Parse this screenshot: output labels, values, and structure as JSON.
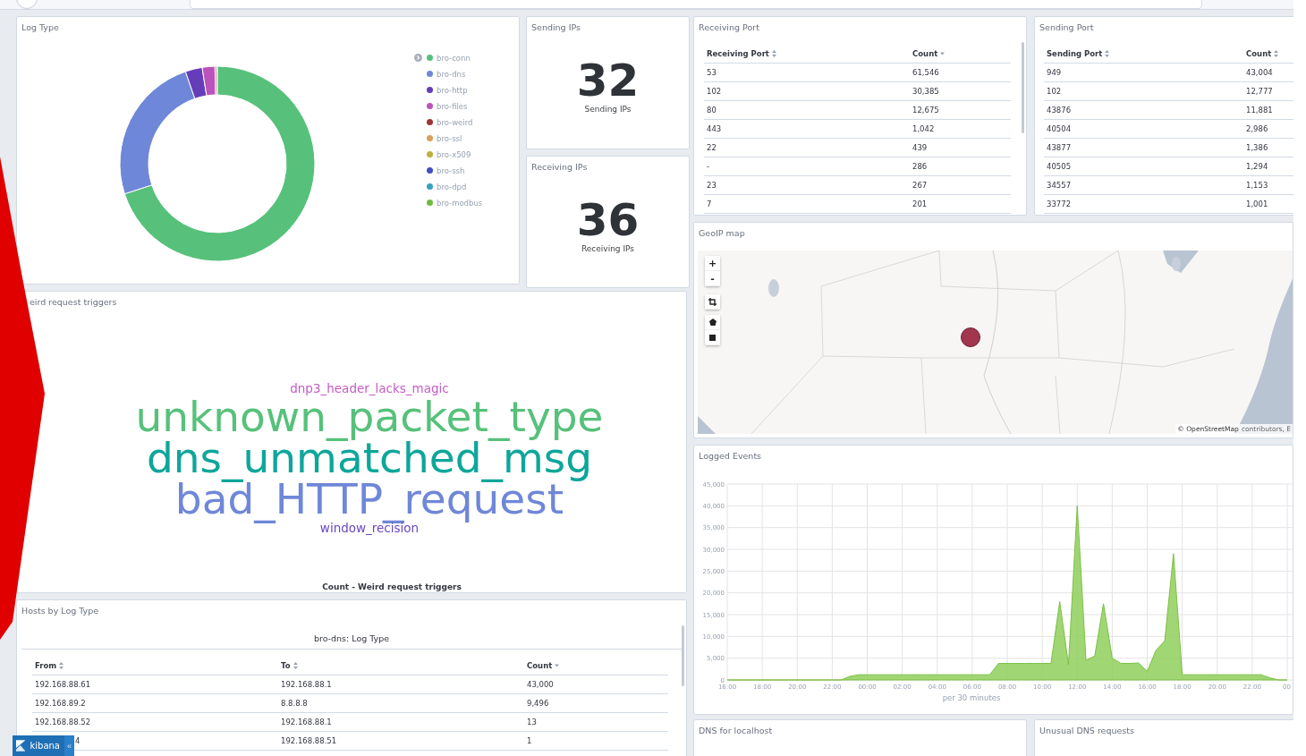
{
  "log_type": {
    "title": "Log Type",
    "legend": [
      {
        "label": "bro-conn",
        "color": "#57c17b"
      },
      {
        "label": "bro-dns",
        "color": "#6f87d8"
      },
      {
        "label": "bro-http",
        "color": "#663db8"
      },
      {
        "label": "bro-files",
        "color": "#bc52bc"
      },
      {
        "label": "bro-weird",
        "color": "#9e3533"
      },
      {
        "label": "bro-ssl",
        "color": "#daa05d"
      },
      {
        "label": "bro-x509",
        "color": "#bfaf40"
      },
      {
        "label": "bro-ssh",
        "color": "#4050bf"
      },
      {
        "label": "bro-dpd",
        "color": "#36a2bf"
      },
      {
        "label": "bro-modbus",
        "color": "#70ba40"
      }
    ]
  },
  "sending_ips": {
    "title": "Sending IPs",
    "value": "32",
    "label": "Sending IPs"
  },
  "receiving_ips": {
    "title": "Receiving IPs",
    "value": "36",
    "label": "Receiving IPs"
  },
  "receiving_port": {
    "title": "Receiving Port",
    "columns": [
      {
        "label": "Receiving Port",
        "sorted": false
      },
      {
        "label": "Count",
        "sorted": true
      }
    ],
    "rows": [
      [
        "53",
        "61,546"
      ],
      [
        "102",
        "30,385"
      ],
      [
        "80",
        "12,675"
      ],
      [
        "443",
        "1,042"
      ],
      [
        "22",
        "439"
      ],
      [
        "-",
        "286"
      ],
      [
        "23",
        "267"
      ],
      [
        "7",
        "201"
      ]
    ]
  },
  "sending_port": {
    "title": "Sending Port",
    "columns": [
      {
        "label": "Sending Port",
        "sorted": false
      },
      {
        "label": "Count",
        "sorted": false
      }
    ],
    "rows": [
      [
        "949",
        "43,004"
      ],
      [
        "102",
        "12,777"
      ],
      [
        "43876",
        "11,881"
      ],
      [
        "40504",
        "2,986"
      ],
      [
        "43877",
        "1,386"
      ],
      [
        "40505",
        "1,294"
      ],
      [
        "34557",
        "1,153"
      ],
      [
        "33772",
        "1,001"
      ]
    ]
  },
  "weird_triggers": {
    "title": "eird request triggers",
    "words": [
      {
        "text": "dnp3_header_lacks_magic",
        "kind": "small",
        "color": "#c65bc6"
      },
      {
        "text": "unknown_packet_type",
        "kind": "large",
        "color": "#57c17b"
      },
      {
        "text": "dns_unmatched_msg",
        "kind": "large",
        "color": "#0ea69a"
      },
      {
        "text": "bad_HTTP_request",
        "kind": "large",
        "color": "#6f87d8"
      },
      {
        "text": "window_recision",
        "kind": "small",
        "color": "#6a47c2"
      }
    ],
    "caption": "Count - Weird request triggers"
  },
  "hosts_by_log_type": {
    "title": "Hosts by Log Type",
    "subtitle": "bro-dns: Log Type",
    "columns": [
      {
        "label": "From",
        "sorted": false
      },
      {
        "label": "To",
        "sorted": false
      },
      {
        "label": "Count",
        "sorted": true
      }
    ],
    "rows": [
      [
        "192.168.88.61",
        "192.168.88.1",
        "43,000"
      ],
      [
        "192.168.89.2",
        "8.8.8.8",
        "9,496"
      ],
      [
        "192.168.88.52",
        "192.168.88.1",
        "13"
      ],
      [
        "4",
        "192.168.88.51",
        "1"
      ]
    ]
  },
  "geoip_map": {
    "title": "GeoIP map",
    "zoom_in": "+",
    "zoom_out": "-",
    "attribution_link": "© OpenStreetMap",
    "attribution_text": "contributors, E"
  },
  "logged_events": {
    "title": "Logged Events",
    "chart_data": {
      "type": "area",
      "xlabel": "per 30 minutes",
      "categories": [
        "16:00",
        null,
        null,
        null,
        "18:00",
        null,
        null,
        null,
        "20:00",
        null,
        null,
        null,
        "22:00",
        null,
        null,
        null,
        "00:00",
        null,
        null,
        null,
        "02:00",
        null,
        null,
        null,
        "04:00",
        null,
        null,
        null,
        "06:00",
        null,
        null,
        null,
        "08:00",
        null,
        null,
        null,
        "10:00",
        null,
        null,
        null,
        "12:00",
        null,
        null,
        null,
        "14:00",
        null,
        null,
        null,
        "16:00",
        null,
        null,
        null,
        "18:00",
        null,
        null,
        null,
        "20:00",
        null,
        null,
        null,
        "22:00",
        null,
        null,
        null,
        "00"
      ],
      "series": [
        {
          "color": "#8fcf5a",
          "values": [
            0,
            0,
            0,
            0,
            0,
            0,
            0,
            0,
            0,
            0,
            0,
            0,
            0,
            0,
            800,
            1200,
            1200,
            1200,
            1200,
            1200,
            1200,
            1200,
            1200,
            1200,
            1200,
            1200,
            1200,
            1200,
            1200,
            1200,
            1200,
            3800,
            3800,
            3800,
            3800,
            3800,
            3800,
            3800,
            18000,
            3500,
            40000,
            4500,
            5500,
            17500,
            5000,
            3800,
            3800,
            3900,
            2000,
            6800,
            9000,
            29000,
            1200,
            1200,
            1200,
            1200,
            1200,
            1200,
            1200,
            1200,
            1200,
            1200,
            500,
            0,
            0
          ]
        }
      ],
      "ylim": [
        0,
        45000
      ],
      "grid": true,
      "yticks": [
        {
          "value": 0,
          "label": "0"
        },
        {
          "value": 5000,
          "label": "5,000"
        },
        {
          "value": 10000,
          "label": "10,000"
        },
        {
          "value": 15000,
          "label": "15,000"
        },
        {
          "value": 20000,
          "label": "20,000"
        },
        {
          "value": 25000,
          "label": "25,000"
        },
        {
          "value": 30000,
          "label": "30,000"
        },
        {
          "value": 35000,
          "label": "35,000"
        },
        {
          "value": 40000,
          "label": "40,000"
        },
        {
          "value": 45000,
          "label": "45,000"
        }
      ]
    }
  },
  "dns_localhost": {
    "title": "DNS for localhost"
  },
  "unusual_dns": {
    "title": "Unusual DNS requests"
  },
  "kibana_badge": {
    "label": "kibana",
    "collapse": "«"
  }
}
